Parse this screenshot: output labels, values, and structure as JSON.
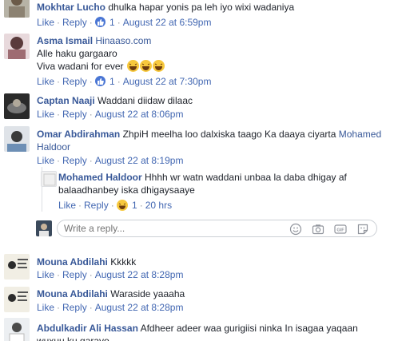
{
  "comments": [
    {
      "name": "Mokhtar Lucho",
      "text": "dhulka hapar yonis pa leh iyo wixi wadaniya",
      "like": "Like",
      "reply": "Reply",
      "reactions": "1",
      "time": "August 22 at 6:59pm"
    },
    {
      "name": "Asma Ismail",
      "link": "Hinaaso.com",
      "line1": "Alle haku gargaaro",
      "line2": "Viva wadani for ever",
      "like": "Like",
      "reply": "Reply",
      "reactions": "1",
      "time": "August 22 at 7:30pm"
    },
    {
      "name": "Captan Naaji",
      "text": "Waddani diidaw dilaac",
      "like": "Like",
      "reply": "Reply",
      "time": "August 22 at 8:06pm"
    },
    {
      "name": "Omar Abdirahman",
      "text": "ZhpiH meelha loo dalxiska taago Ka daaya ciyarta",
      "mention": "Mohamed Haldoor",
      "like": "Like",
      "reply": "Reply",
      "time": "August 22 at 8:19pm"
    },
    {
      "name": "Mouna Abdilahi",
      "text": "Kkkkk",
      "like": "Like",
      "reply": "Reply",
      "time": "August 22 at 8:28pm"
    },
    {
      "name": "Mouna Abdilahi",
      "text": "Waraside yaaaha",
      "like": "Like",
      "reply": "Reply",
      "time": "August 22 at 8:28pm"
    },
    {
      "name": "Abdulkadir Ali Hassan",
      "text_line1": "Afdheer adeer waa gurigiisi ninka In isagaa yaqaan",
      "text_line2": "wuxuu ku garayo"
    }
  ],
  "reply": {
    "name": "Mohamed Haldoor",
    "text_line1": "Hhhh wr watn waddani unbaa la daba dhigay af",
    "text_line2": "balaadhanbey iska dhigaysaaye",
    "like": "Like",
    "reply": "Reply",
    "reactions": "1",
    "time": "20 hrs"
  },
  "reply_input": {
    "placeholder": "Write a reply..."
  },
  "dot": "·",
  "colors": {
    "link": "#385898",
    "action": "#4267b2",
    "meta": "#90949c",
    "like_badge": "#4a76d4",
    "haha": "#f7c83d"
  }
}
